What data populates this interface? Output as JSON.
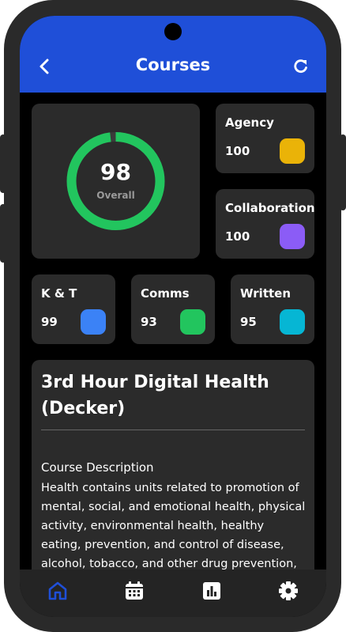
{
  "header": {
    "title": "Courses",
    "back_icon": "chevron-left-icon",
    "refresh_icon": "refresh-icon"
  },
  "overall": {
    "score": "98",
    "label": "Overall",
    "progress": 0.98,
    "ring_color": "#22c55e"
  },
  "metrics": [
    {
      "name": "Agency",
      "value": "100",
      "color": "#eab308"
    },
    {
      "name": "Collaboration",
      "value": "100",
      "color": "#8b5cf6"
    },
    {
      "name": "K & T",
      "value": "99",
      "color": "#3b82f6"
    },
    {
      "name": "Comms",
      "value": "93",
      "color": "#22c55e"
    },
    {
      "name": "Written",
      "value": "95",
      "color": "#06b6d4"
    }
  ],
  "course": {
    "title": "3rd Hour Digital Health (Decker)",
    "description_label": "Course Description",
    "description": "Health contains units related to promotion of mental, social, and emotional health, physical activity, environmental health, healthy eating, prevention, and control of disease, alcohol, tobacco, and other drug prevention, promotion"
  },
  "nav": {
    "items": [
      "home-icon",
      "calendar-icon",
      "chart-icon",
      "settings-icon"
    ],
    "active": "home-icon",
    "active_color": "#1f4fd8"
  }
}
